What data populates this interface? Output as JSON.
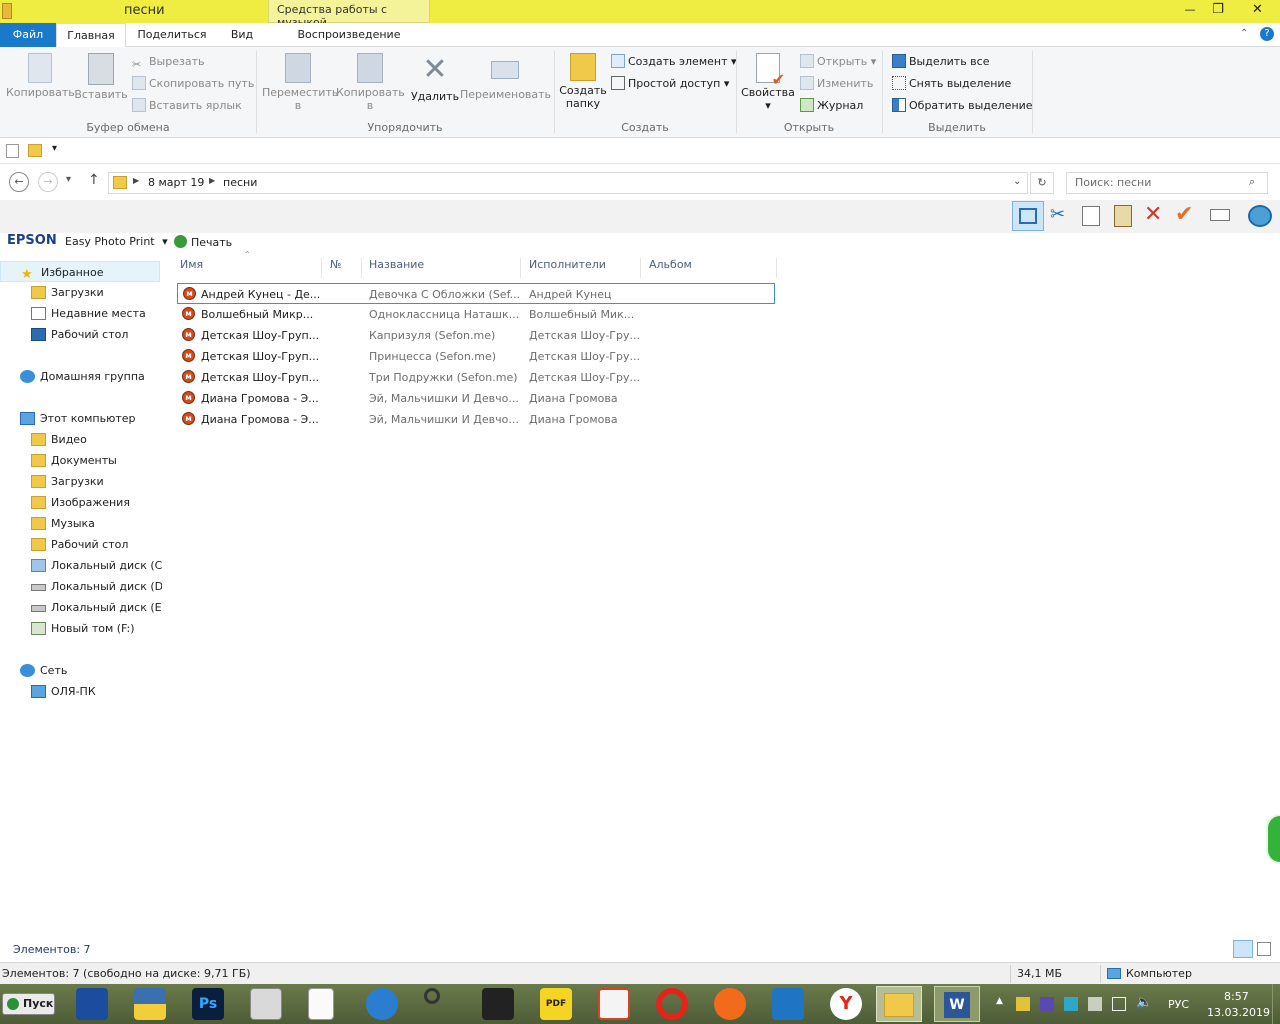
{
  "window": {
    "title": "песни",
    "context_tab": "Средства работы с музыкой",
    "controls": {
      "minimize": "—",
      "maximize": "❐",
      "close": "✕"
    }
  },
  "tabs": [
    "Файл",
    "Главная",
    "Поделиться",
    "Вид",
    "Воспроизведение"
  ],
  "ribbon": {
    "clipboard": {
      "copy": "Копировать",
      "paste": "Вставить",
      "cut": "Вырезать",
      "copy_path": "Скопировать путь",
      "paste_shortcut": "Вставить ярлык",
      "group": "Буфер обмена"
    },
    "organize": {
      "move_to_1": "Переместить",
      "move_to_2": "в",
      "copy_to_1": "Копировать",
      "copy_to_2": "в",
      "delete": "Удалить",
      "rename": "Переименовать",
      "group": "Упорядочить"
    },
    "new": {
      "new_folder_1": "Создать",
      "new_folder_2": "папку",
      "new_item": "Создать элемент",
      "easy_access": "Простой доступ",
      "group": "Создать"
    },
    "open": {
      "properties": "Свойства",
      "open": "Открыть",
      "edit": "Изменить",
      "history": "Журнал",
      "group": "Открыть"
    },
    "select": {
      "select_all": "Выделить все",
      "select_none": "Снять выделение",
      "invert": "Обратить выделение",
      "group": "Выделить"
    }
  },
  "address": {
    "crumbs": [
      "8 март 19",
      "песни"
    ],
    "search_placeholder": "Поиск: песни"
  },
  "epson": {
    "logo": "EPSON",
    "app": "Easy Photo Print",
    "print": "Печать"
  },
  "nav": {
    "favorites": "Избранное",
    "fav_items": [
      "Загрузки",
      "Недавние места",
      "Рабочий стол"
    ],
    "homegroup": "Домашняя группа",
    "computer": "Этот компьютер",
    "pc_items": [
      "Видео",
      "Документы",
      "Загрузки",
      "Изображения",
      "Музыка",
      "Рабочий стол",
      "Локальный диск (C:",
      "Локальный диск (D:",
      "Локальный диск (E:)",
      "Новый том (F:)"
    ],
    "network": "Сеть",
    "net_items": [
      "ОЛЯ-ПК"
    ]
  },
  "columns": {
    "name": "Имя",
    "num": "№",
    "title": "Название",
    "artists": "Исполнители",
    "album": "Альбом"
  },
  "files": [
    {
      "name": "Андрей Кунец - Де...",
      "num": "",
      "title": "Девочка С Обложки (Sef...",
      "artist": "Андрей Кунец",
      "album": ""
    },
    {
      "name": "Волшебный Микр...",
      "num": "",
      "title": "Одноклассница Наташк...",
      "artist": "Волшебный Мик...",
      "album": ""
    },
    {
      "name": "Детская Шоу-Груп...",
      "num": "",
      "title": "Капризуля (Sefon.me)",
      "artist": "Детская Шоу-Гру...",
      "album": ""
    },
    {
      "name": "Детская Шоу-Груп...",
      "num": "",
      "title": "Принцесса (Sefon.me)",
      "artist": "Детская Шоу-Гру...",
      "album": ""
    },
    {
      "name": "Детская Шоу-Груп...",
      "num": "",
      "title": "Три Подружки (Sefon.me)",
      "artist": "Детская Шоу-Гру...",
      "album": ""
    },
    {
      "name": "Диана Громова - Э...",
      "num": "",
      "title": "Эй, Мальчишки И Девчо...",
      "artist": "Диана Громова",
      "album": ""
    },
    {
      "name": "Диана Громова - Э...",
      "num": "",
      "title": "Эй, Мальчишки И Девчо...",
      "artist": "Диана Громова",
      "album": ""
    }
  ],
  "status": {
    "items": "Элементов: 7",
    "details": "Элементов: 7 (свободно на диске: 9,71 ГБ)",
    "size": "34,1 МБ",
    "location": "Компьютер"
  },
  "taskbar": {
    "start": "Пуск",
    "lang": "РУС",
    "time": "8:57",
    "date": "13.03.2019"
  }
}
